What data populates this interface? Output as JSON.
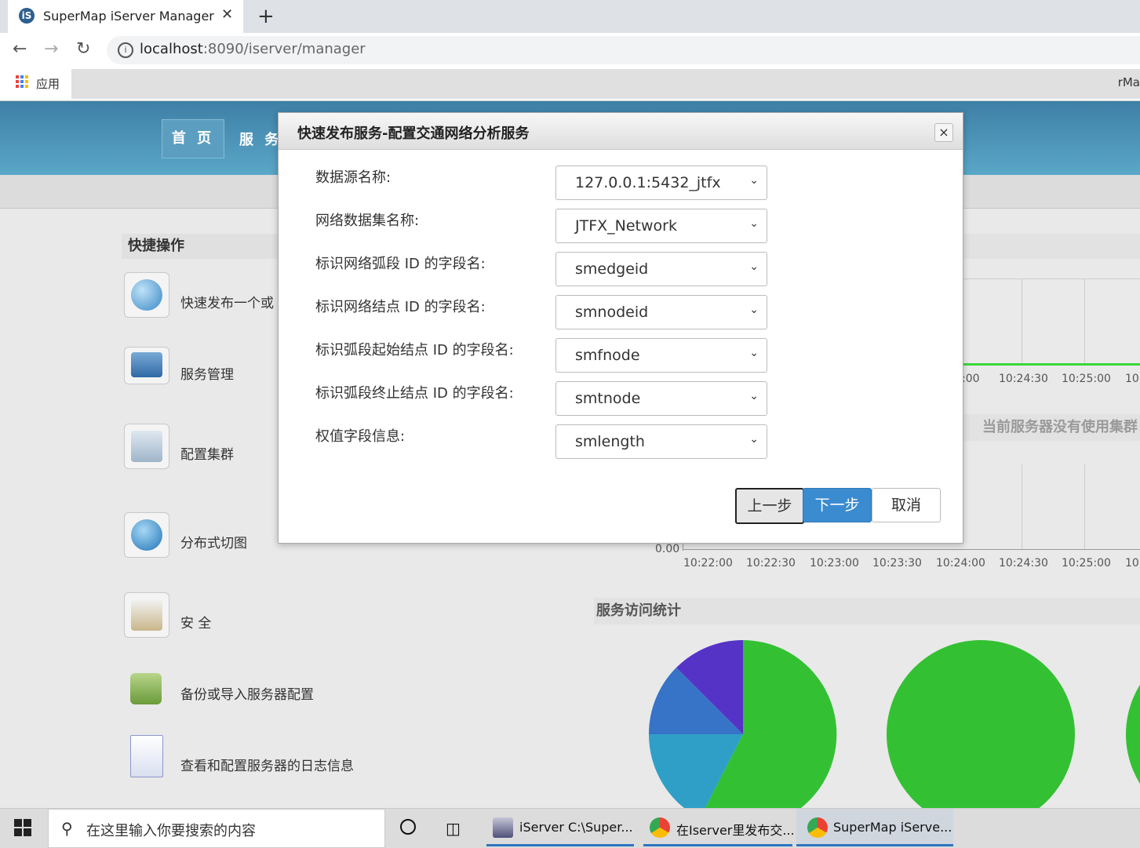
{
  "browser": {
    "tab_title": "SuperMap iServer Manager",
    "tab_close": "✕",
    "new_tab": "+",
    "url_host": "localhost",
    "url_path": ":8090/iserver/manager",
    "bookmark_apps": "应用",
    "bookmark_right": "rMa"
  },
  "header": {
    "nav": [
      "首 页",
      "服 务"
    ]
  },
  "quick_ops": {
    "title": "快捷操作",
    "items": [
      {
        "label": "快速发布一个或",
        "icon": "globe-icon"
      },
      {
        "label": "服务管理",
        "icon": "gear-window-icon"
      },
      {
        "label": "配置集群",
        "icon": "computers-icon"
      },
      {
        "label": "分布式切图",
        "icon": "globe-grid-icon"
      },
      {
        "label": "安 全",
        "icon": "lock-icon"
      },
      {
        "label": "备份或导入服务器配置",
        "icon": "backup-icon"
      },
      {
        "label": "查看和配置服务器的日志信息",
        "icon": "log-icon"
      }
    ]
  },
  "right_panel": {
    "top_ticks": [
      ":00",
      "10:24:30",
      "10:25:00",
      "10:"
    ],
    "cluster_msg": "当前服务器没有使用集群",
    "zero_label": "0.00",
    "bottom_ticks": [
      "10:22:00",
      "10:22:30",
      "10:23:00",
      "10:23:30",
      "10:24:00",
      "10:24:30",
      "10:25:00",
      "10:"
    ],
    "stats_title": "服务访问统计"
  },
  "modal": {
    "title": "快速发布服务-配置交通网络分析服务",
    "close": "×",
    "fields": [
      {
        "label": "数据源名称:",
        "value": "127.0.0.1:5432_jtfx"
      },
      {
        "label": "网络数据集名称:",
        "value": "JTFX_Network"
      },
      {
        "label": "标识网络弧段 ID 的字段名:",
        "value": "smedgeid"
      },
      {
        "label": "标识网络结点 ID 的字段名:",
        "value": "smnodeid"
      },
      {
        "label": "标识弧段起始结点 ID 的字段名:",
        "value": "smfnode"
      },
      {
        "label": "标识弧段终止结点 ID 的字段名:",
        "value": "smtnode"
      },
      {
        "label": "权值字段信息:",
        "value": "smlength"
      }
    ],
    "buttons": {
      "prev": "上一步",
      "next": "下一步",
      "cancel": "取消"
    }
  },
  "taskbar": {
    "search_placeholder": "在这里输入你要搜索的内容",
    "apps": [
      {
        "label": "iServer C:\\Super..."
      },
      {
        "label": "在Iserver里发布交..."
      },
      {
        "label": "SuperMap iServe..."
      }
    ]
  },
  "colors": {
    "header_blue": "#3e7fa6",
    "primary_button": "#3b8bd0",
    "chart_green": "#33c133"
  }
}
